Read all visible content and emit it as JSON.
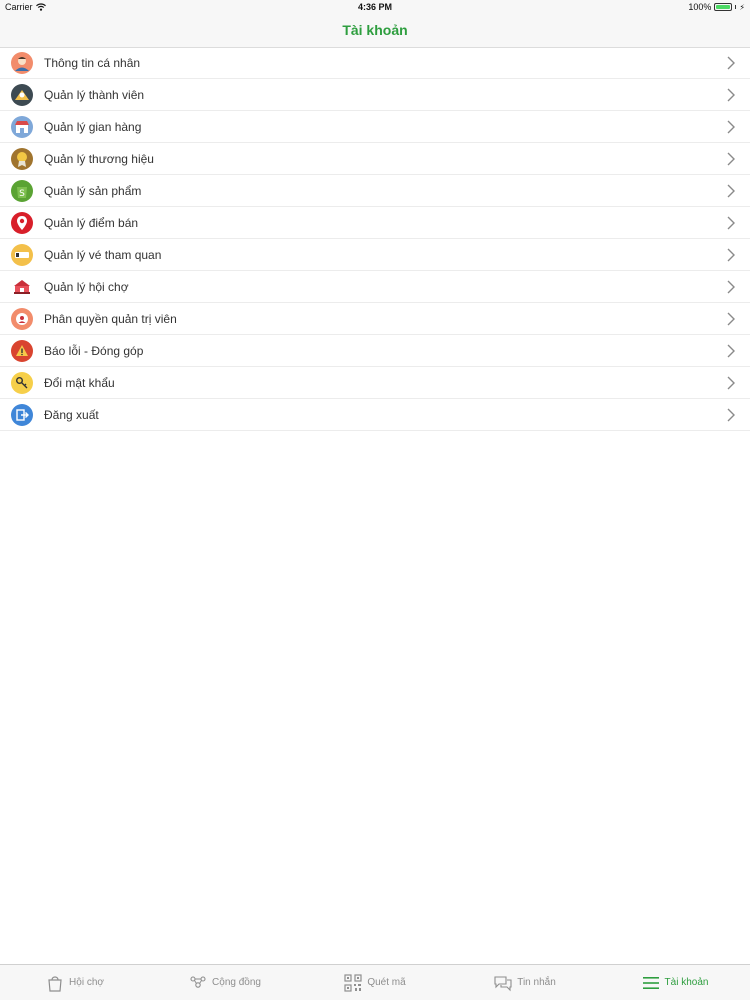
{
  "status_bar": {
    "carrier": "Carrier",
    "time": "4:36 PM",
    "battery": "100%",
    "battery_level": 1.0
  },
  "nav": {
    "title": "Tài khoản"
  },
  "menu": [
    {
      "label": "Thông tin cá nhân",
      "icon": "user-profile-icon"
    },
    {
      "label": "Quản lý thành viên",
      "icon": "members-icon"
    },
    {
      "label": "Quản lý gian hàng",
      "icon": "store-icon"
    },
    {
      "label": "Quản lý thương hiệu",
      "icon": "brand-medal-icon"
    },
    {
      "label": "Quản lý sản phẩm",
      "icon": "product-bag-icon"
    },
    {
      "label": "Quản lý điểm bán",
      "icon": "location-pin-icon"
    },
    {
      "label": "Quản lý vé tham quan",
      "icon": "ticket-icon"
    },
    {
      "label": "Quản lý hội chợ",
      "icon": "fair-tent-icon"
    },
    {
      "label": "Phân quyền quản trị viên",
      "icon": "admin-roles-icon"
    },
    {
      "label": "Báo lỗi - Đóng góp",
      "icon": "warning-icon"
    },
    {
      "label": "Đổi mật khẩu",
      "icon": "key-icon"
    },
    {
      "label": "Đăng xuất",
      "icon": "logout-icon"
    }
  ],
  "tabs": [
    {
      "label": "Hội chợ",
      "icon": "shopping-bag-icon",
      "active": false
    },
    {
      "label": "Cộng đồng",
      "icon": "community-icon",
      "active": false
    },
    {
      "label": "Quét mã",
      "icon": "qr-code-icon",
      "active": false
    },
    {
      "label": "Tin nhắn",
      "icon": "chat-bubbles-icon",
      "active": false
    },
    {
      "label": "Tài khoản",
      "icon": "menu-lines-icon",
      "active": true
    }
  ],
  "colors": {
    "accent": "#2e9e3f",
    "inactive_tab": "#8e8e8e",
    "bar_background": "#f7f7f7"
  }
}
